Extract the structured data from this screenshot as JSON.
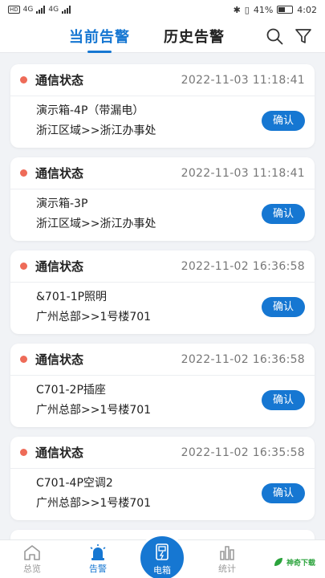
{
  "statusbar": {
    "left_badge": "HD",
    "signal1": "4G",
    "signal2": "4G",
    "battery_percent": "41%",
    "time": "4:02"
  },
  "header": {
    "tab_current": "当前告警",
    "tab_history": "历史告警"
  },
  "alerts": [
    {
      "status": "通信状态",
      "time": "2022-11-03 11:18:41",
      "device": "演示箱-4P（带漏电）",
      "area": "浙江区域>>浙江办事处",
      "action": "确认"
    },
    {
      "status": "通信状态",
      "time": "2022-11-03 11:18:41",
      "device": "演示箱-3P",
      "area": "浙江区域>>浙江办事处",
      "action": "确认"
    },
    {
      "status": "通信状态",
      "time": "2022-11-02 16:36:58",
      "device": "&701-1P照明",
      "area": "广州总部>>1号楼701",
      "action": "确认"
    },
    {
      "status": "通信状态",
      "time": "2022-11-02 16:36:58",
      "device": "C701-2P插座",
      "area": "广州总部>>1号楼701",
      "action": "确认"
    },
    {
      "status": "通信状态",
      "time": "2022-11-02 16:35:58",
      "device": "C701-4P空调2",
      "area": "广州总部>>1号楼701",
      "action": "确认"
    }
  ],
  "bottomnav": {
    "overview": "总览",
    "alarm": "告警",
    "box": "电箱",
    "stats": "统计"
  },
  "watermark": "神奇下载",
  "colors": {
    "accent": "#1677d2",
    "alert_dot": "#ee6b58",
    "background": "#f1f3f6"
  }
}
